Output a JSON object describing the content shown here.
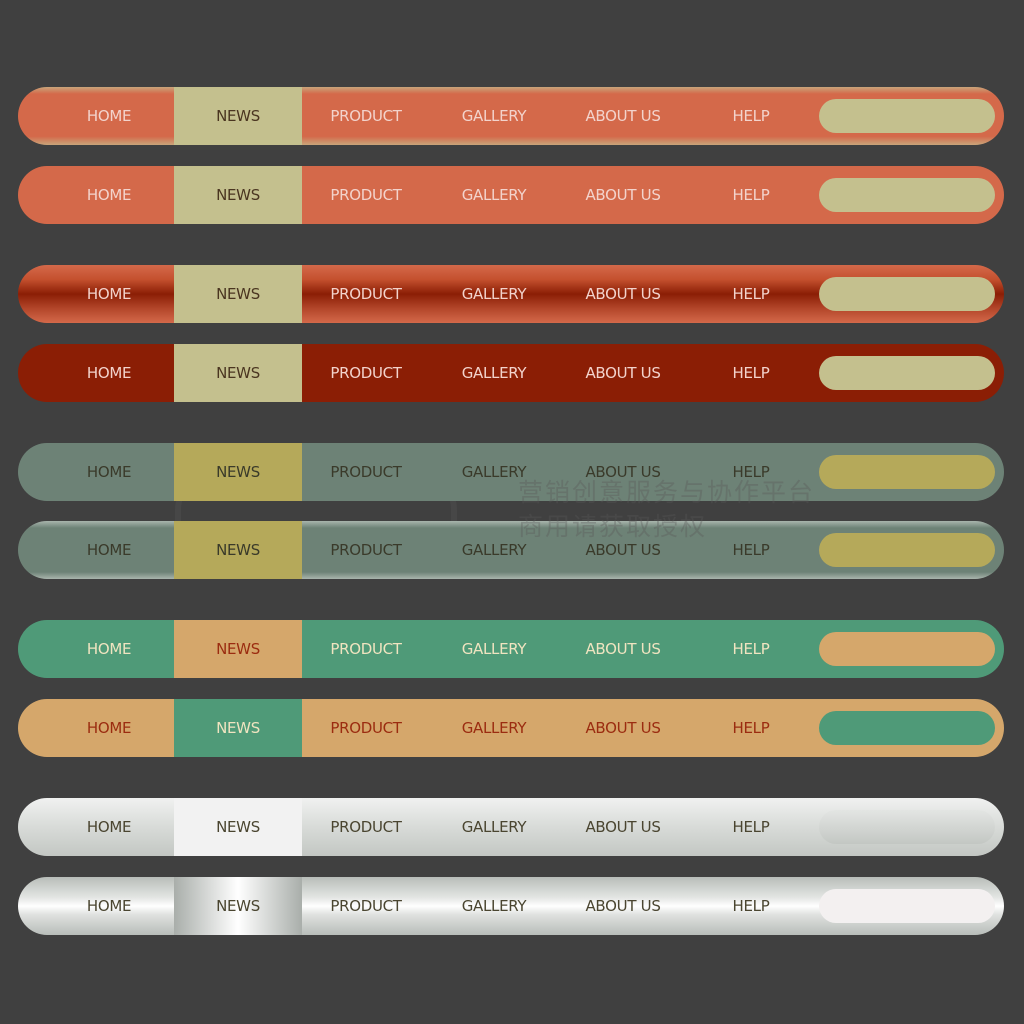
{
  "menu_labels": [
    "HOME",
    "NEWS",
    "PRODUCT",
    "GALLERY",
    "ABOUT US",
    "HELP"
  ],
  "search": {
    "value": ""
  },
  "watermark": {
    "line1": "营销创意服务与协作平台",
    "line2": "商用请获取授权"
  },
  "bars": [
    {
      "style": "orange-glossy",
      "bar_color": "#d4694a",
      "highlight_color": "#c4c08e",
      "text_color": "#f3d3cc",
      "highlight_text_color": "#4a3520",
      "search_color": "#c4c08e",
      "active_item": "NEWS"
    },
    {
      "style": "orange-flat",
      "bar_color": "#d4694a",
      "highlight_color": "#c4c08e",
      "text_color": "#f3d3cc",
      "highlight_text_color": "#4a3520",
      "search_color": "#c4c08e",
      "active_item": "NEWS"
    },
    {
      "style": "rust-gradient",
      "bar_color": "#8b1e05",
      "highlight_color": "#c4c08e",
      "text_color": "#f3d3cc",
      "highlight_text_color": "#4a3520",
      "search_color": "#c4c08e",
      "active_item": "NEWS"
    },
    {
      "style": "rust-flat",
      "bar_color": "#8b1e05",
      "highlight_color": "#c4c08e",
      "text_color": "#f3d3cc",
      "highlight_text_color": "#4a3520",
      "search_color": "#c4c08e",
      "active_item": "NEWS"
    },
    {
      "style": "slate-flat",
      "bar_color": "#6d8276",
      "highlight_color": "#b5a95a",
      "text_color": "#3a3a2a",
      "highlight_text_color": "#3a3a2a",
      "search_color": "#b5a95a",
      "active_item": "NEWS"
    },
    {
      "style": "slate-glossy",
      "bar_color": "#6d8276",
      "highlight_color": "#b5a95a",
      "text_color": "#3a3a2a",
      "highlight_text_color": "#3a3a2a",
      "search_color": "#b5a95a",
      "active_item": "NEWS"
    },
    {
      "style": "green-flat",
      "bar_color": "#4f9a78",
      "highlight_color": "#d5a76b",
      "text_color": "#f0e4c0",
      "highlight_text_color": "#9b2c10",
      "search_color": "#d5a76b",
      "active_item": "NEWS"
    },
    {
      "style": "tan-flat",
      "bar_color": "#d5a76b",
      "highlight_color": "#4f9a78",
      "text_color": "#9b2c10",
      "highlight_text_color": "#f0e4c0",
      "search_color": "#4f9a78",
      "active_item": "NEWS"
    },
    {
      "style": "silver-matte",
      "bar_color": "#d8dbd8",
      "highlight_color": "#f2f2f2",
      "text_color": "#4a4530",
      "highlight_text_color": "#4a4530",
      "search_color": "#cfd2cf",
      "active_item": "NEWS"
    },
    {
      "style": "silver-chrome",
      "bar_color": "#e6e8e6",
      "highlight_color": "#d0d3d0",
      "text_color": "#4a4530",
      "highlight_text_color": "#4a4530",
      "search_color": "#f3f0f0",
      "active_item": "NEWS"
    }
  ]
}
